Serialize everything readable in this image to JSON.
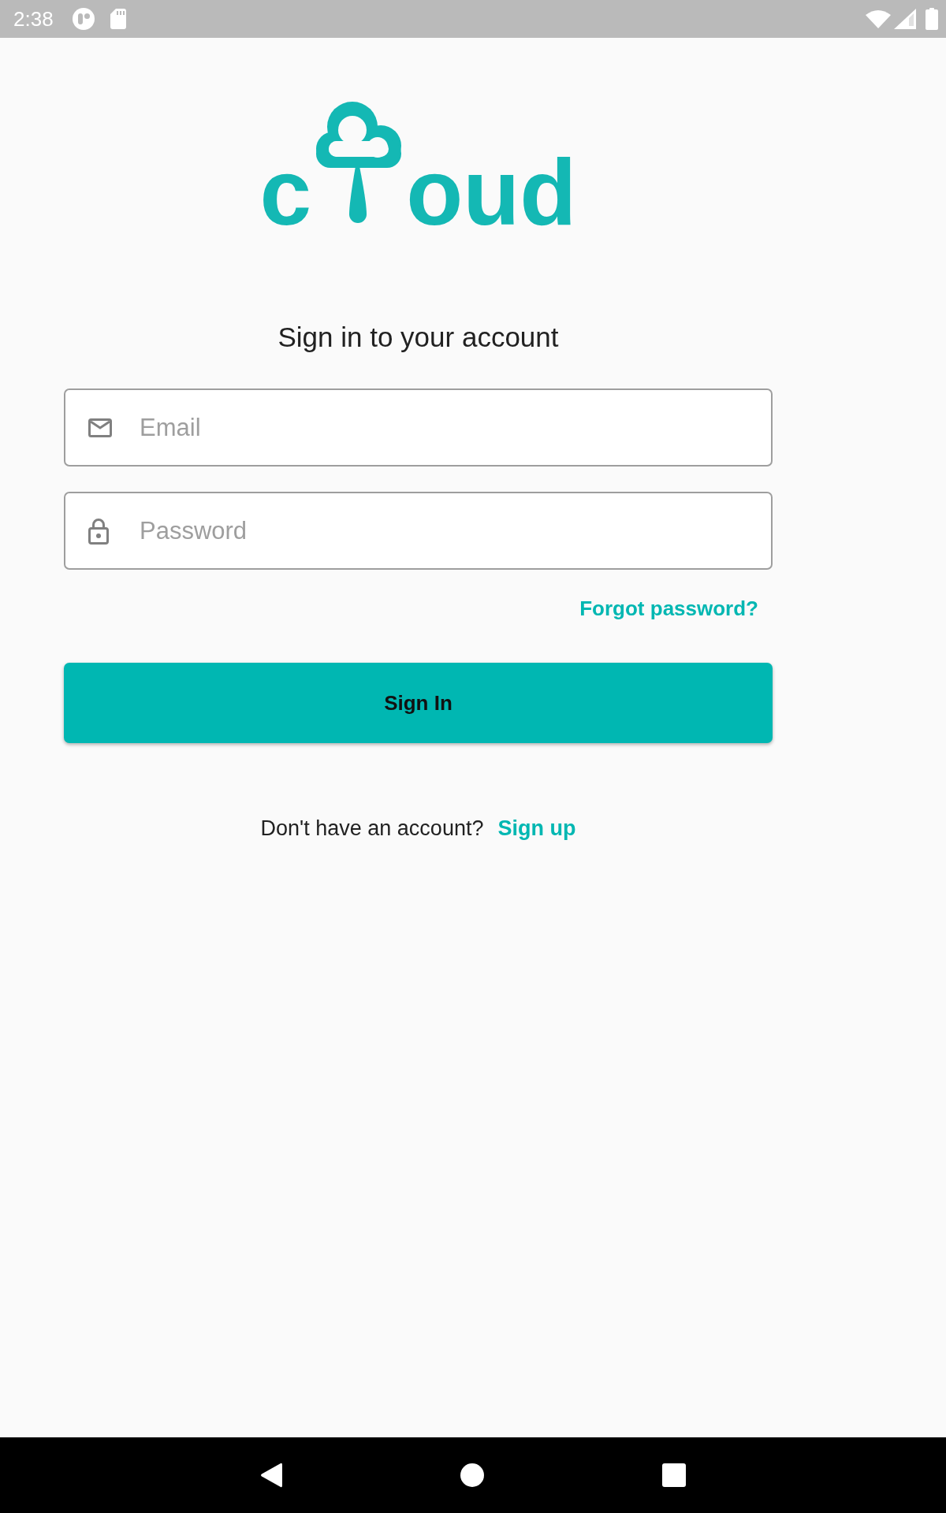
{
  "status_bar": {
    "time": "2:38"
  },
  "logo": {
    "letters_before": "c",
    "letters_after": "oud"
  },
  "heading": "Sign in to your account",
  "fields": [
    {
      "kind": "email",
      "placeholder": "Email"
    },
    {
      "kind": "password",
      "placeholder": "Password"
    }
  ],
  "forgot_link": "Forgot password?",
  "sign_in_button": "Sign In",
  "signup_prompt": {
    "text": "Don't have an account?",
    "link": "Sign up"
  }
}
